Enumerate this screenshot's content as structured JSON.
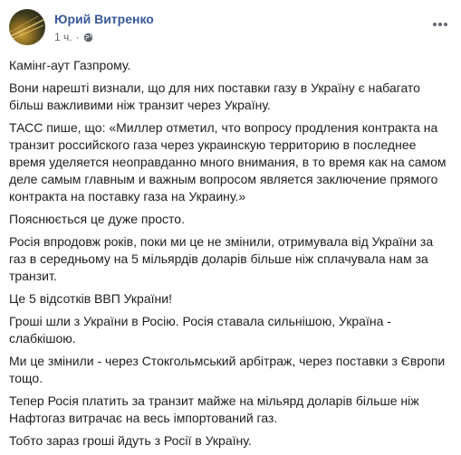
{
  "post": {
    "author": "Юрий Витренко",
    "time": "1 ч.",
    "separator": "·",
    "icons": {
      "avatar": "profile-photo",
      "privacy": "globe-icon",
      "options": "more-horizontal-icon"
    },
    "colors": {
      "author_link": "#385898",
      "meta_text": "#616770",
      "body_text": "#1c1e21"
    },
    "paragraphs": [
      "Камінг-аут Газпрому.",
      "Вони нарешті визнали, що для них поставки газу в Україну є набагато більш важливими ніж транзит через Україну.",
      "ТАСС пише, що: «Миллер отметил, что вопросу продления контракта на транзит российского газа через украинскую территорию в последнее время уделяется неоправданно много внимания, в то время как на самом деле самым главным и важным вопросом является заключение прямого контракта на поставку газа на Украину.»",
      "Пояснюється це дуже просто.",
      "Росія впродовж років, поки ми це не змінили, отримувала від України за газ в середньому на 5 мільярдів доларів більше ніж сплачувала нам за транзит.",
      "Це 5 відсотків ВВП України!",
      "Гроші шли з України в Росію. Росія ставала сильнішою, Україна - слабкішою.",
      "Ми це змінили - через Стокгольмський арбітраж, через поставки з Європи тощо.",
      "Тепер Росія платить за транзит майже на мільярд доларів більше ніж Нафтогаз витрачає на весь імпортований газ.",
      "Тобто зараз гроші йдуть з Росії в Україну."
    ]
  }
}
